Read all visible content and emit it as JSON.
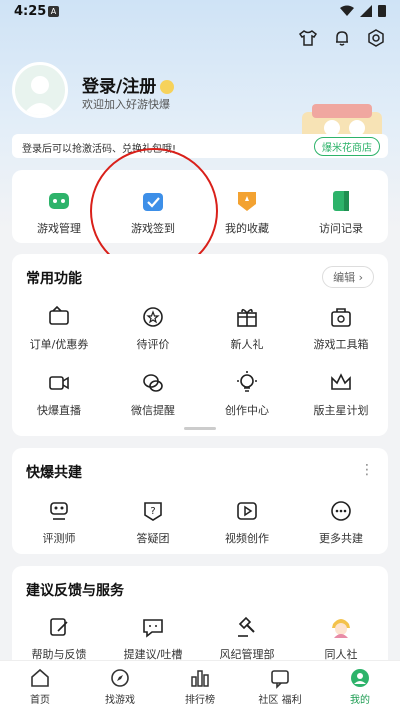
{
  "status_bar": {
    "time": "4:25",
    "notif_letter": "A"
  },
  "profile": {
    "title": "登录/注册",
    "subtitle": "欢迎加入好游快爆"
  },
  "banner": {
    "text": "登录后可以抢激活码、兑换礼包哦!",
    "button": "爆米花商店"
  },
  "quick": [
    {
      "label": "游戏管理",
      "icon": "gamepad-icon"
    },
    {
      "label": "游戏签到",
      "icon": "calendar-check-icon"
    },
    {
      "label": "我的收藏",
      "icon": "star-shield-icon"
    },
    {
      "label": "访问记录",
      "icon": "book-icon"
    }
  ],
  "common": {
    "title": "常用功能",
    "edit": "编辑",
    "items": [
      {
        "label": "订单/优惠券",
        "icon": "coupon-icon"
      },
      {
        "label": "待评价",
        "icon": "comment-star-icon"
      },
      {
        "label": "新人礼",
        "icon": "gift-icon"
      },
      {
        "label": "游戏工具箱",
        "icon": "toolbox-icon"
      },
      {
        "label": "快爆直播",
        "icon": "video-icon"
      },
      {
        "label": "微信提醒",
        "icon": "wechat-icon"
      },
      {
        "label": "创作中心",
        "icon": "lightbulb-icon"
      },
      {
        "label": "版主星计划",
        "icon": "crown-icon"
      }
    ]
  },
  "cobuild": {
    "title": "快爆共建",
    "items": [
      {
        "label": "评测师",
        "icon": "reviewer-icon"
      },
      {
        "label": "答疑团",
        "icon": "question-icon"
      },
      {
        "label": "视频创作",
        "icon": "play-icon"
      },
      {
        "label": "更多共建",
        "icon": "more-icon"
      }
    ]
  },
  "feedback": {
    "title": "建议反馈与服务",
    "items": [
      {
        "label": "帮助与反馈",
        "icon": "edit-icon"
      },
      {
        "label": "提建议/吐槽",
        "icon": "chat-icon"
      },
      {
        "label": "风纪管理部",
        "icon": "gavel-icon"
      },
      {
        "label": "同人社",
        "icon": "character-icon"
      }
    ]
  },
  "tabs": [
    {
      "label": "首页",
      "icon": "home-icon"
    },
    {
      "label": "找游戏",
      "icon": "compass-icon"
    },
    {
      "label": "排行榜",
      "icon": "ranking-icon"
    },
    {
      "label": "社区 福利",
      "icon": "community-icon"
    },
    {
      "label": "我的",
      "icon": "profile-icon"
    }
  ],
  "colors": {
    "accent": "#2db36a",
    "highlight_circle": "#d9201a"
  }
}
